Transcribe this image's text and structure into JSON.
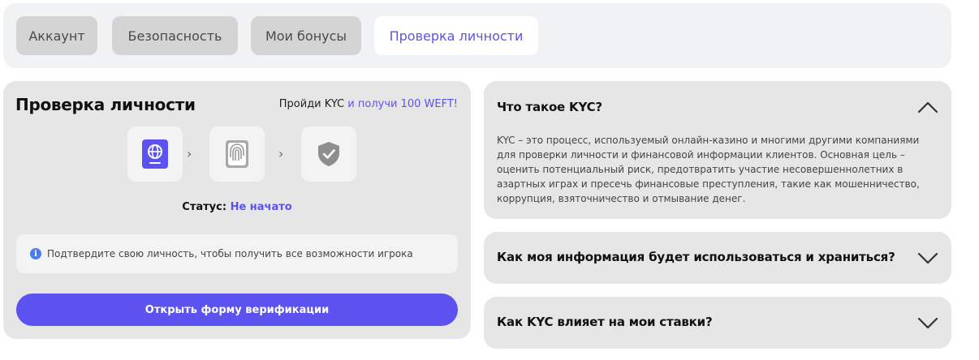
{
  "tabs": [
    {
      "label": "Аккаунт",
      "active": false
    },
    {
      "label": "Безопасность",
      "active": false
    },
    {
      "label": "Мои бонусы",
      "active": false
    },
    {
      "label": "Проверка личности",
      "active": true
    }
  ],
  "kyc": {
    "title": "Проверка личности",
    "promo_prefix": "Пройди KYC",
    "promo_accent": "и получи 100 WEFT!",
    "steps": [
      {
        "icon": "passport-icon",
        "state": "active"
      },
      {
        "icon": "fingerprint-icon",
        "state": "pending"
      },
      {
        "icon": "shield-check-icon",
        "state": "pending"
      }
    ],
    "status_label": "Статус:",
    "status_value": "Не начато",
    "notice_text": "Подтвердите свою личность, чтобы получить все возможности игрока",
    "button_label": "Открыть форму верификации"
  },
  "faq": [
    {
      "question": "Что такое KYC?",
      "expanded": true,
      "answer": "KYC – это процесс, используемый онлайн-казино и многими другими компаниями для проверки личности и финансовой информации клиентов. Основная цель – оценить потенциальный риск, предотвратить участие несовершеннолетних в азартных играх и пресечь финансовые преступления, такие как мошенничество, коррупция, взяточничество и отмывание денег."
    },
    {
      "question": "Как моя информация будет использоваться и храниться?",
      "expanded": false
    },
    {
      "question": "Как KYC влияет на мои ставки?",
      "expanded": false
    }
  ],
  "colors": {
    "accent": "#5b52f0",
    "card_bg": "#e6e6e6",
    "tab_inactive_bg": "#d4d4d4",
    "info_icon": "#4a7cf0"
  }
}
